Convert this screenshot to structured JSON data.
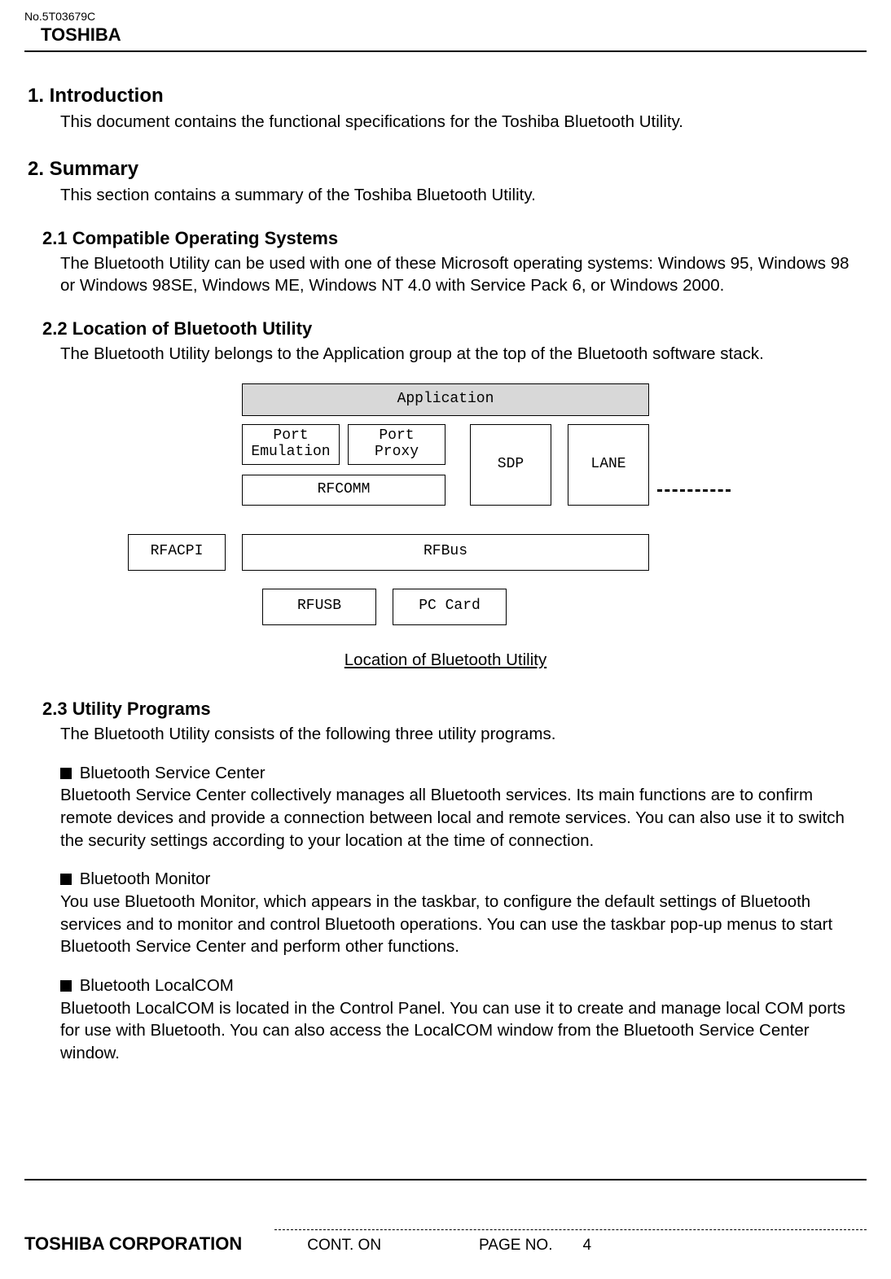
{
  "header": {
    "doc_no": "No.5T03679C",
    "brand": "TOSHIBA"
  },
  "s1": {
    "heading": "1. Introduction",
    "p1": "This document contains the functional specifications for the Toshiba Bluetooth Utility."
  },
  "s2": {
    "heading": "2. Summary",
    "p1": "This section contains a summary of the Toshiba Bluetooth Utility."
  },
  "s21": {
    "heading": "2.1 Compatible Operating Systems",
    "p1": "The Bluetooth Utility can be used with one of these Microsoft operating systems: Windows 95, Windows 98 or Windows 98SE, Windows ME, Windows NT 4.0 with Service Pack 6, or Windows 2000."
  },
  "s22": {
    "heading": "2.2 Location of Bluetooth Utility",
    "p1": "The Bluetooth Utility belongs to the Application group at the top of the Bluetooth software stack."
  },
  "diagram": {
    "application": "Application",
    "port_emulation": "Port\nEmulation",
    "port_proxy": "Port\nProxy",
    "sdp": "SDP",
    "lane": "LANE",
    "rfcomm": "RFCOMM",
    "rfacpi": "RFACPI",
    "rfbus": "RFBus",
    "rfusb": "RFUSB",
    "pc_card": "PC Card",
    "caption": "Location of Bluetooth Utility"
  },
  "s23": {
    "heading": "2.3 Utility Programs",
    "p1": "The Bluetooth Utility consists of the following three utility programs.",
    "b1_title": " Bluetooth Service Center",
    "b1_body": "Bluetooth Service Center collectively manages all Bluetooth services. Its main functions are to confirm remote devices and provide a connection between local and remote services. You can also use it to switch the security settings according to your location at the time of connection.",
    "b2_title": " Bluetooth Monitor",
    "b2_body": "You use Bluetooth Monitor, which appears in the taskbar, to configure the default settings of Bluetooth services and to monitor and control Bluetooth operations. You can use the taskbar pop-up menus to start Bluetooth Service Center and perform other functions.",
    "b3_title": " Bluetooth LocalCOM",
    "b3_body": "Bluetooth LocalCOM is located in the Control Panel. You can use it to create and manage local COM ports for use with Bluetooth. You can also access the LocalCOM window from the Bluetooth Service Center window."
  },
  "footer": {
    "corp": "TOSHIBA CORPORATION",
    "cont_on": "CONT. ON",
    "page_label": "PAGE NO.",
    "page_no": "4"
  }
}
